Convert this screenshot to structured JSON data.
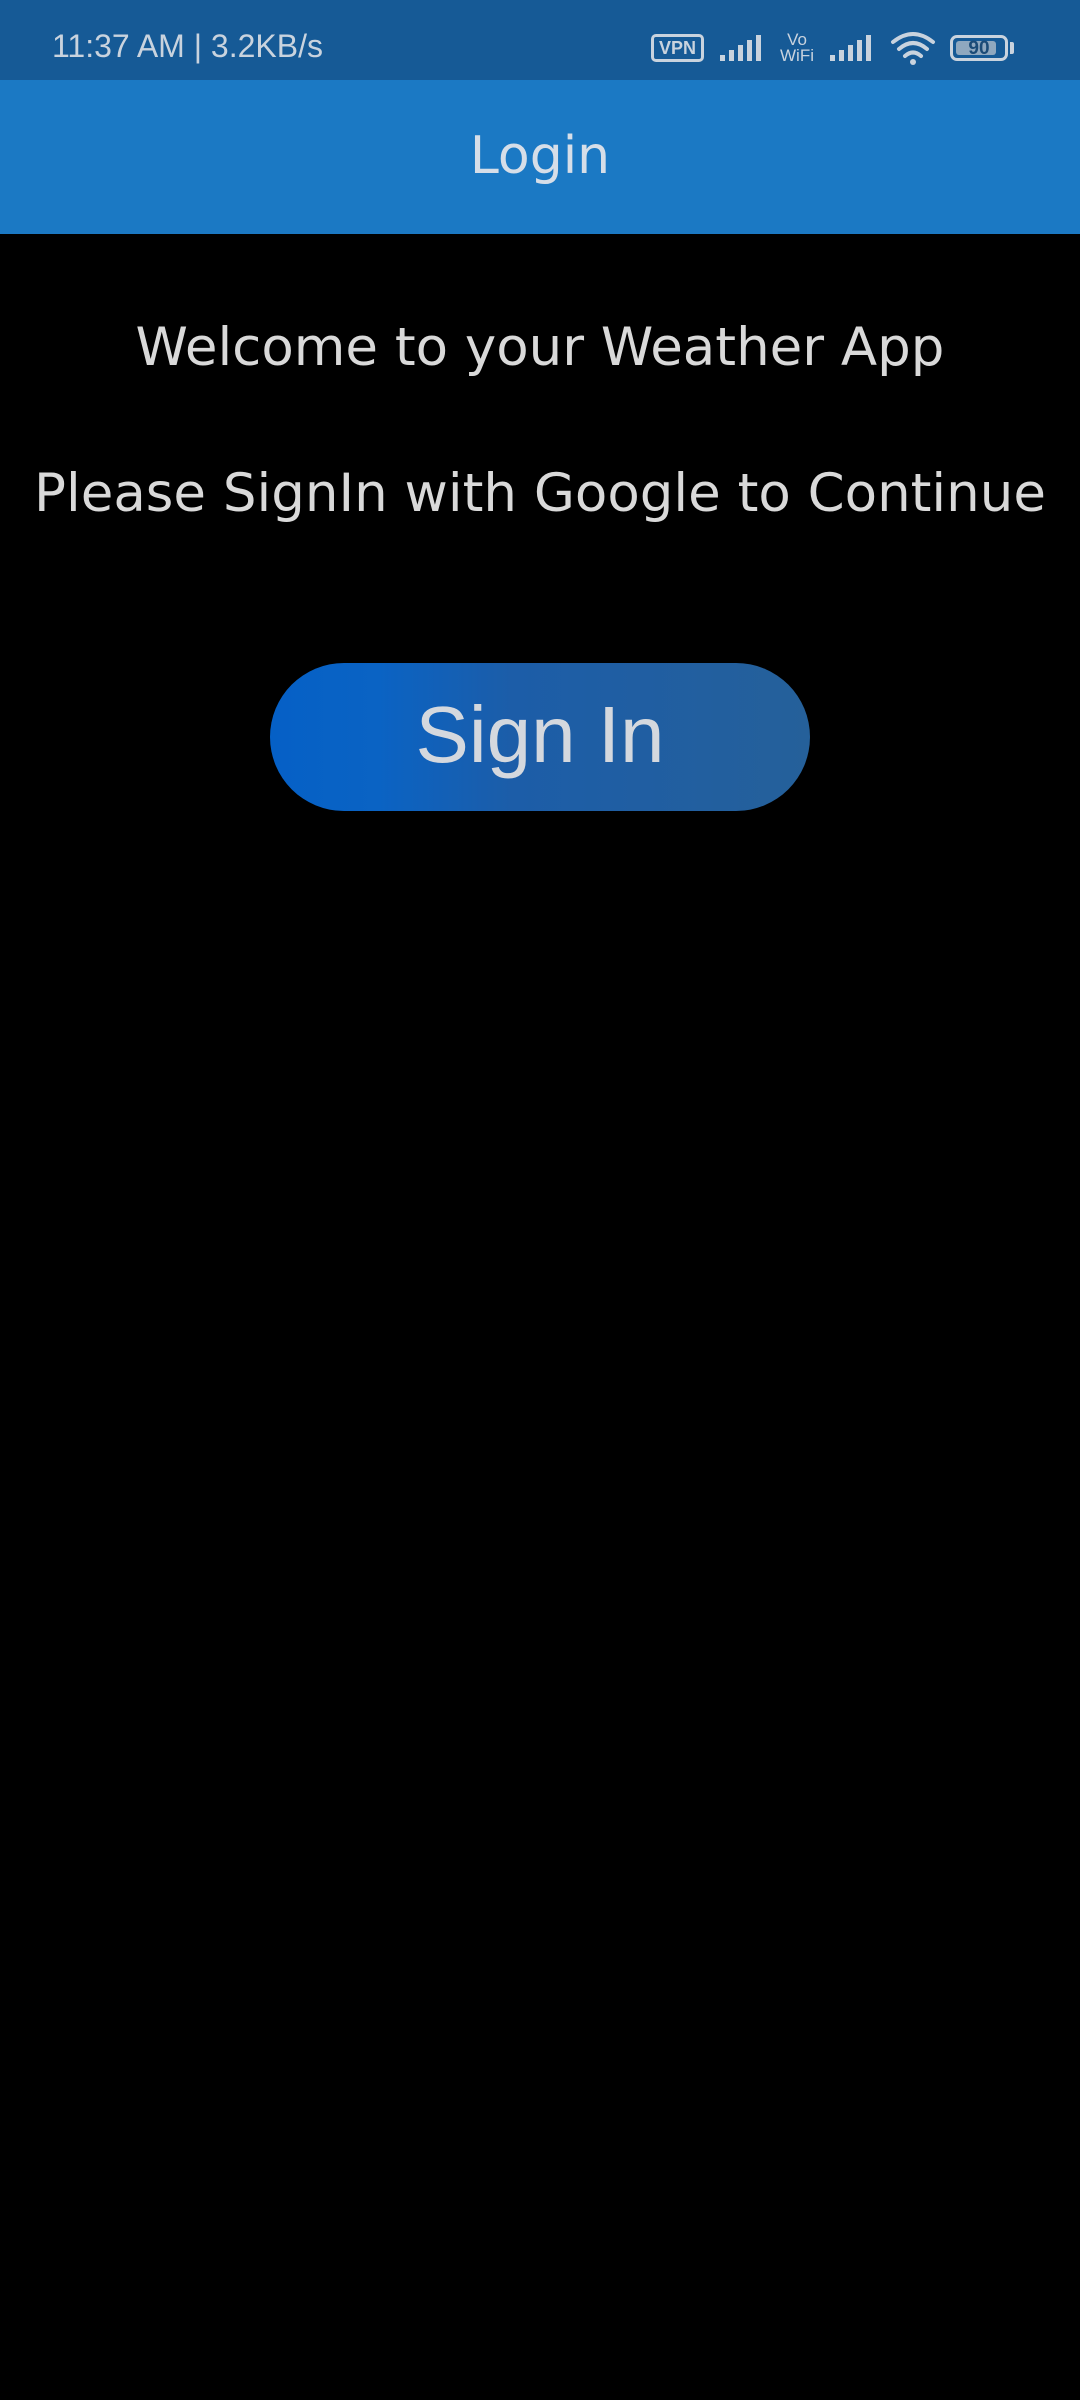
{
  "status_bar": {
    "time_speed": "11:37 AM | 3.2KB/s",
    "vpn_label": "VPN",
    "vowifi_top": "Vo",
    "vowifi_bottom": "WiFi",
    "battery_level": "90"
  },
  "app_bar": {
    "title": "Login"
  },
  "content": {
    "welcome_text": "Welcome to your Weather App",
    "instruction_text": "Please SignIn with Google to Continue",
    "sign_in_label": "Sign In"
  },
  "colors": {
    "status_bar_bg": "#165a96",
    "app_bar_bg": "#1b79c4",
    "background": "#000000",
    "button_start": "#0560c6",
    "button_end": "#25609a",
    "text": "#d9d9d9"
  },
  "icons": [
    "vpn-icon",
    "signal-icon",
    "vowifi-icon",
    "wifi-icon",
    "battery-icon"
  ]
}
